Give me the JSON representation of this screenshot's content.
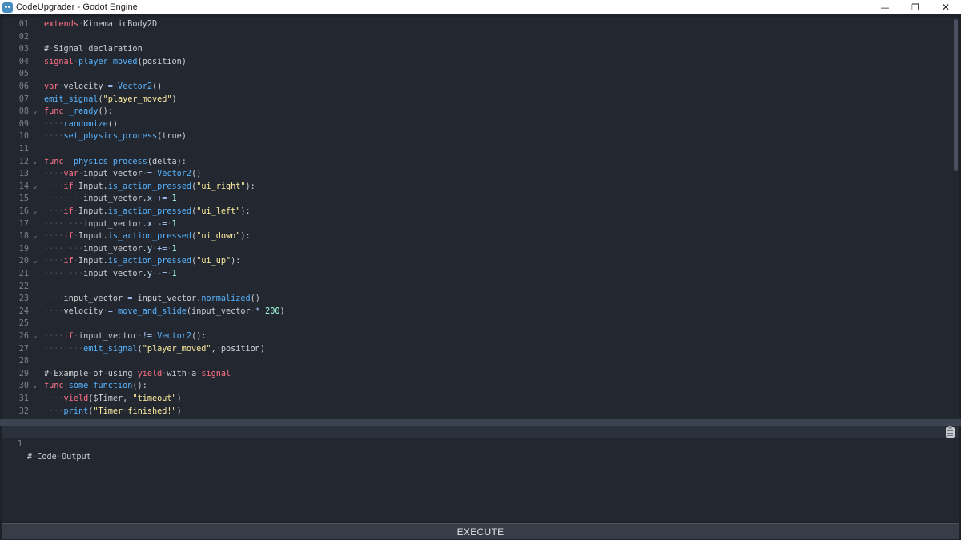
{
  "window": {
    "title": "CodeUpgrader - Godot Engine",
    "controls": {
      "minimize": "—",
      "restore": "❐",
      "close": "✕"
    }
  },
  "editor": {
    "lines": [
      {
        "num": "01",
        "fold": false,
        "tokens": [
          [
            "kw",
            "extends"
          ],
          [
            "ws",
            "·"
          ],
          [
            "t",
            "KinematicBody2D"
          ]
        ]
      },
      {
        "num": "02",
        "fold": false,
        "tokens": []
      },
      {
        "num": "03",
        "fold": false,
        "tokens": [
          [
            "cm",
            "#"
          ],
          [
            "ws",
            "·"
          ],
          [
            "cm",
            "Signal"
          ],
          [
            "ws",
            "·"
          ],
          [
            "cm",
            "declaration"
          ]
        ]
      },
      {
        "num": "04",
        "fold": false,
        "tokens": [
          [
            "kw",
            "signal"
          ],
          [
            "ws",
            "·"
          ],
          [
            "fn",
            "player_moved"
          ],
          [
            "t",
            "(position)"
          ]
        ]
      },
      {
        "num": "05",
        "fold": false,
        "tokens": []
      },
      {
        "num": "06",
        "fold": false,
        "tokens": [
          [
            "kw",
            "var"
          ],
          [
            "ws",
            "·"
          ],
          [
            "t",
            "velocity"
          ],
          [
            "ws",
            "·"
          ],
          [
            "op",
            "="
          ],
          [
            "ws",
            "·"
          ],
          [
            "fn",
            "Vector2"
          ],
          [
            "t",
            "()"
          ]
        ]
      },
      {
        "num": "07",
        "fold": false,
        "tokens": [
          [
            "fn",
            "emit_signal"
          ],
          [
            "t",
            "("
          ],
          [
            "str",
            "\"player_moved\""
          ],
          [
            "t",
            ")"
          ]
        ]
      },
      {
        "num": "08",
        "fold": true,
        "tokens": [
          [
            "kw",
            "func"
          ],
          [
            "ws",
            "·"
          ],
          [
            "fn",
            "_ready"
          ],
          [
            "t",
            "():"
          ]
        ]
      },
      {
        "num": "09",
        "fold": false,
        "tokens": [
          [
            "ws",
            "····"
          ],
          [
            "fn",
            "randomize"
          ],
          [
            "t",
            "()"
          ]
        ]
      },
      {
        "num": "10",
        "fold": false,
        "tokens": [
          [
            "ws",
            "····"
          ],
          [
            "fn",
            "set_physics_process"
          ],
          [
            "t",
            "(true)"
          ]
        ]
      },
      {
        "num": "11",
        "fold": false,
        "tokens": []
      },
      {
        "num": "12",
        "fold": true,
        "tokens": [
          [
            "kw",
            "func"
          ],
          [
            "ws",
            "·"
          ],
          [
            "fn",
            "_physics_process"
          ],
          [
            "t",
            "(delta):"
          ]
        ]
      },
      {
        "num": "13",
        "fold": false,
        "tokens": [
          [
            "ws",
            "····"
          ],
          [
            "kw",
            "var"
          ],
          [
            "ws",
            "·"
          ],
          [
            "t",
            "input_vector"
          ],
          [
            "ws",
            "·"
          ],
          [
            "op",
            "="
          ],
          [
            "ws",
            "·"
          ],
          [
            "fn",
            "Vector2"
          ],
          [
            "t",
            "()"
          ]
        ]
      },
      {
        "num": "14",
        "fold": true,
        "tokens": [
          [
            "ws",
            "····"
          ],
          [
            "kw",
            "if"
          ],
          [
            "ws",
            "·"
          ],
          [
            "t",
            "Input."
          ],
          [
            "fn",
            "is_action_pressed"
          ],
          [
            "t",
            "("
          ],
          [
            "str",
            "\"ui_right\""
          ],
          [
            "t",
            "):"
          ]
        ]
      },
      {
        "num": "15",
        "fold": false,
        "tokens": [
          [
            "ws",
            "········"
          ],
          [
            "t",
            "input_vector."
          ],
          [
            "pr",
            "x"
          ],
          [
            "ws",
            "·"
          ],
          [
            "op",
            "+="
          ],
          [
            "ws",
            "·"
          ],
          [
            "num",
            "1"
          ]
        ]
      },
      {
        "num": "16",
        "fold": true,
        "tokens": [
          [
            "ws",
            "····"
          ],
          [
            "kw",
            "if"
          ],
          [
            "ws",
            "·"
          ],
          [
            "t",
            "Input."
          ],
          [
            "fn",
            "is_action_pressed"
          ],
          [
            "t",
            "("
          ],
          [
            "str",
            "\"ui_left\""
          ],
          [
            "t",
            "):"
          ]
        ]
      },
      {
        "num": "17",
        "fold": false,
        "tokens": [
          [
            "ws",
            "········"
          ],
          [
            "t",
            "input_vector."
          ],
          [
            "pr",
            "x"
          ],
          [
            "ws",
            "·"
          ],
          [
            "op",
            "-="
          ],
          [
            "ws",
            "·"
          ],
          [
            "num",
            "1"
          ]
        ]
      },
      {
        "num": "18",
        "fold": true,
        "tokens": [
          [
            "ws",
            "····"
          ],
          [
            "kw",
            "if"
          ],
          [
            "ws",
            "·"
          ],
          [
            "t",
            "Input."
          ],
          [
            "fn",
            "is_action_pressed"
          ],
          [
            "t",
            "("
          ],
          [
            "str",
            "\"ui_down\""
          ],
          [
            "t",
            "):"
          ]
        ]
      },
      {
        "num": "19",
        "fold": false,
        "tokens": [
          [
            "ws",
            "········"
          ],
          [
            "t",
            "input_vector."
          ],
          [
            "pr",
            "y"
          ],
          [
            "ws",
            "·"
          ],
          [
            "op",
            "+="
          ],
          [
            "ws",
            "·"
          ],
          [
            "num",
            "1"
          ]
        ]
      },
      {
        "num": "20",
        "fold": true,
        "tokens": [
          [
            "ws",
            "····"
          ],
          [
            "kw",
            "if"
          ],
          [
            "ws",
            "·"
          ],
          [
            "t",
            "Input."
          ],
          [
            "fn",
            "is_action_pressed"
          ],
          [
            "t",
            "("
          ],
          [
            "str",
            "\"ui_up\""
          ],
          [
            "t",
            "):"
          ]
        ]
      },
      {
        "num": "21",
        "fold": false,
        "tokens": [
          [
            "ws",
            "········"
          ],
          [
            "t",
            "input_vector."
          ],
          [
            "pr",
            "y"
          ],
          [
            "ws",
            "·"
          ],
          [
            "op",
            "-="
          ],
          [
            "ws",
            "·"
          ],
          [
            "num",
            "1"
          ]
        ]
      },
      {
        "num": "22",
        "fold": false,
        "tokens": []
      },
      {
        "num": "23",
        "fold": false,
        "tokens": [
          [
            "ws",
            "····"
          ],
          [
            "t",
            "input_vector"
          ],
          [
            "ws",
            "·"
          ],
          [
            "op",
            "="
          ],
          [
            "ws",
            "·"
          ],
          [
            "t",
            "input_vector."
          ],
          [
            "fn",
            "normalized"
          ],
          [
            "t",
            "()"
          ]
        ]
      },
      {
        "num": "24",
        "fold": false,
        "tokens": [
          [
            "ws",
            "····"
          ],
          [
            "t",
            "velocity"
          ],
          [
            "ws",
            "·"
          ],
          [
            "op",
            "="
          ],
          [
            "ws",
            "·"
          ],
          [
            "fn",
            "move_and_slide"
          ],
          [
            "t",
            "(input_vector"
          ],
          [
            "ws",
            "·"
          ],
          [
            "op",
            "*"
          ],
          [
            "ws",
            "·"
          ],
          [
            "num",
            "200"
          ],
          [
            "t",
            ")"
          ]
        ]
      },
      {
        "num": "25",
        "fold": false,
        "tokens": []
      },
      {
        "num": "26",
        "fold": true,
        "tokens": [
          [
            "ws",
            "····"
          ],
          [
            "kw",
            "if"
          ],
          [
            "ws",
            "·"
          ],
          [
            "t",
            "input_vector"
          ],
          [
            "ws",
            "·"
          ],
          [
            "op",
            "!="
          ],
          [
            "ws",
            "·"
          ],
          [
            "fn",
            "Vector2"
          ],
          [
            "t",
            "():"
          ]
        ]
      },
      {
        "num": "27",
        "fold": false,
        "tokens": [
          [
            "ws",
            "········"
          ],
          [
            "fn",
            "emit_signal"
          ],
          [
            "t",
            "("
          ],
          [
            "str",
            "\"player_moved\""
          ],
          [
            "t",
            ","
          ],
          [
            "ws",
            "·"
          ],
          [
            "t",
            "position)"
          ]
        ]
      },
      {
        "num": "28",
        "fold": false,
        "tokens": []
      },
      {
        "num": "29",
        "fold": false,
        "tokens": [
          [
            "cm",
            "#"
          ],
          [
            "ws",
            "·"
          ],
          [
            "cm",
            "Example"
          ],
          [
            "ws",
            "·"
          ],
          [
            "cm",
            "of"
          ],
          [
            "ws",
            "·"
          ],
          [
            "cm",
            "using"
          ],
          [
            "ws",
            "·"
          ],
          [
            "kw",
            "yield"
          ],
          [
            "ws",
            "·"
          ],
          [
            "cm",
            "with"
          ],
          [
            "ws",
            "·"
          ],
          [
            "cm",
            "a"
          ],
          [
            "ws",
            "·"
          ],
          [
            "kw",
            "signal"
          ]
        ]
      },
      {
        "num": "30",
        "fold": true,
        "tokens": [
          [
            "kw",
            "func"
          ],
          [
            "ws",
            "·"
          ],
          [
            "fn",
            "some_function"
          ],
          [
            "t",
            "():"
          ]
        ]
      },
      {
        "num": "31",
        "fold": false,
        "tokens": [
          [
            "ws",
            "····"
          ],
          [
            "kw",
            "yield"
          ],
          [
            "t",
            "($Timer,"
          ],
          [
            "ws",
            "·"
          ],
          [
            "str",
            "\"timeout\""
          ],
          [
            "t",
            ")"
          ]
        ]
      },
      {
        "num": "32",
        "fold": false,
        "tokens": [
          [
            "ws",
            "····"
          ],
          [
            "fn",
            "print"
          ],
          [
            "t",
            "("
          ],
          [
            "str",
            "\"Timer"
          ],
          [
            "ws",
            "·"
          ],
          [
            "str",
            "finished!\""
          ],
          [
            "t",
            ")"
          ]
        ]
      }
    ]
  },
  "output": {
    "line_number": "1",
    "tokens": [
      [
        "cm",
        "#"
      ],
      [
        "ws",
        "·"
      ],
      [
        "cm",
        "Code"
      ],
      [
        "ws",
        "·"
      ],
      [
        "cm",
        "Output"
      ]
    ]
  },
  "execute_label": "EXECUTE",
  "icons": {
    "app": "godot-icon",
    "fold": "chevron-down-icon",
    "copy": "clipboard-icon"
  },
  "colors": {
    "keyword": "#ff7085",
    "function": "#57b3ff",
    "string": "#ffeda1",
    "number": "#a1ffe0",
    "background": "#232830"
  }
}
